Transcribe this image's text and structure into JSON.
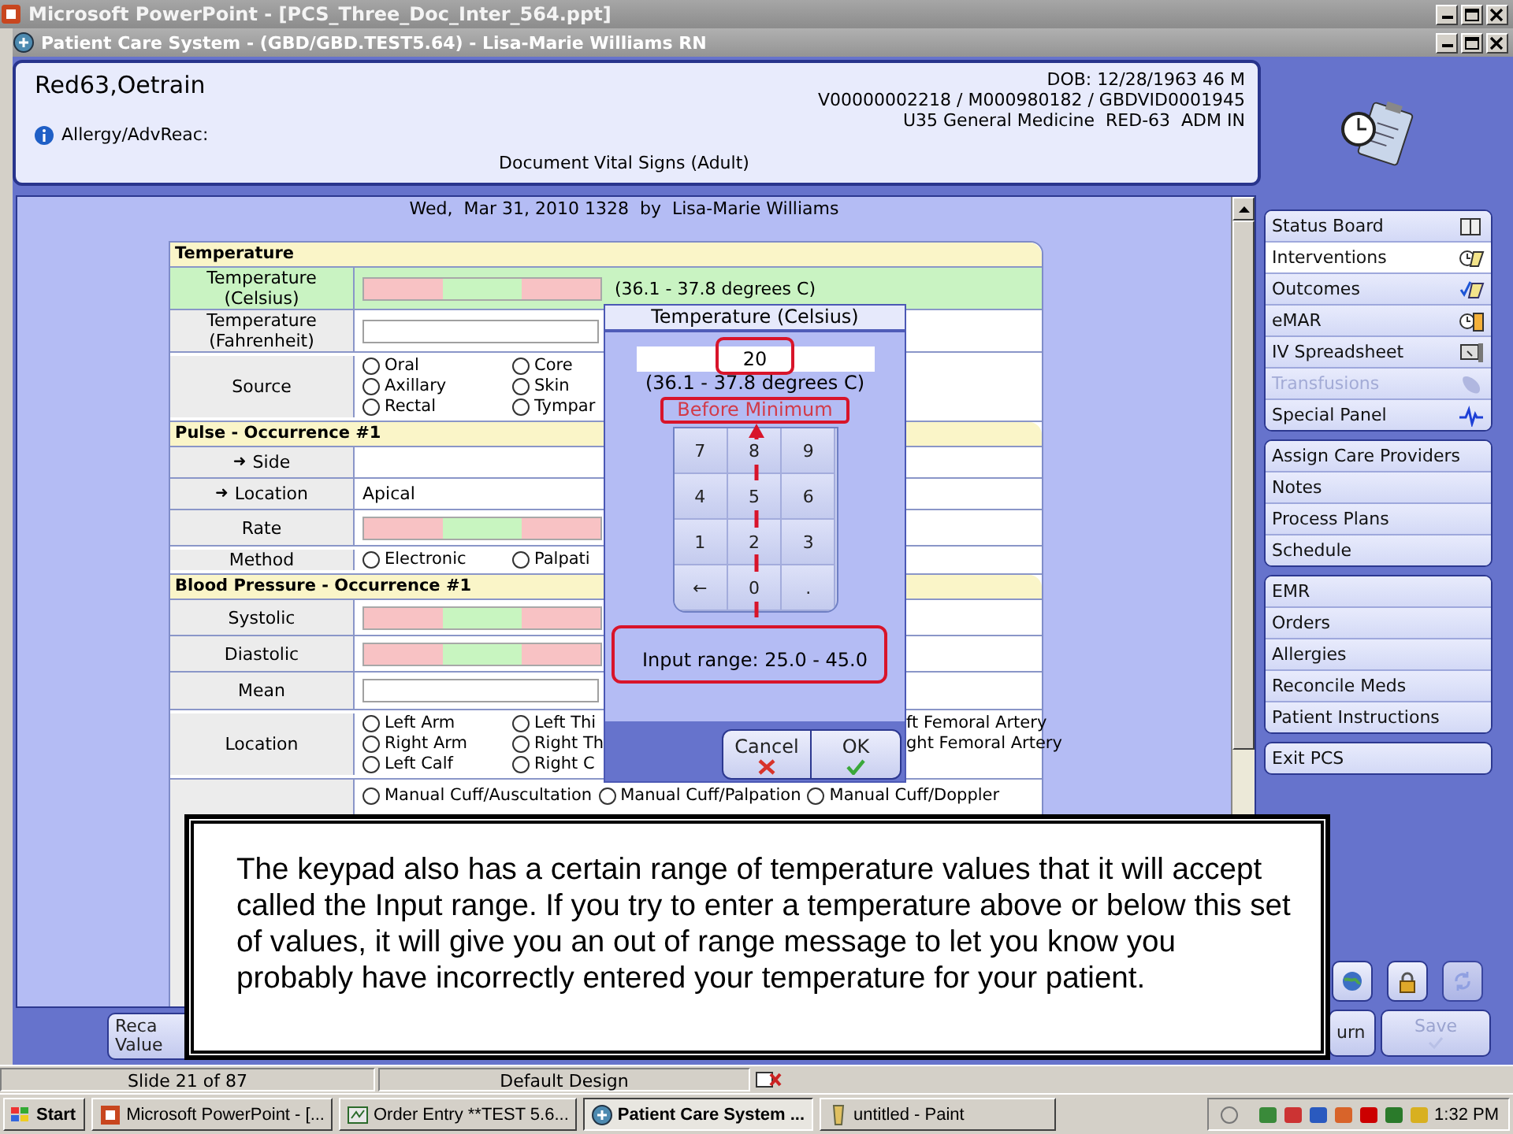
{
  "ppt_window": {
    "title": "Microsoft PowerPoint - [PCS_Three_Doc_Inter_564.ppt]"
  },
  "pcs_window": {
    "title": "Patient Care System - (GBD/GBD.TEST5.64) - Lisa-Marie Williams RN"
  },
  "patient": {
    "name": "Red63,Oetrain",
    "dob": "DOB: 12/28/1963 46 M",
    "ids": "V00000002218 / M000980182 / GBDVID0001945",
    "location": "U35 General Medicine  RED-63  ADM IN",
    "allergy": "Allergy/AdvReac:",
    "document": "Document Vital Signs (Adult)"
  },
  "form": {
    "timestamp": "Wed,  Mar 31, 2010 1328  by  Lisa-Marie Williams",
    "rows": [
      {
        "kind": "section",
        "title": "Temperature"
      },
      {
        "kind": "range",
        "label": "Temperature (Celsius)",
        "active": true,
        "hint": "(36.1 - 37.8 degrees C)"
      },
      {
        "kind": "input",
        "label": "Temperature (Fahrenheit)",
        "active": false
      },
      {
        "kind": "radio",
        "label": "Source",
        "lines": [
          {
            "options": [
              {
                "label": "Oral",
                "selected": false
              },
              {
                "label": "Core",
                "selected": false
              }
            ]
          },
          {
            "options": [
              {
                "label": "Axillary",
                "selected": false
              },
              {
                "label": "Skin",
                "selected": false
              }
            ]
          },
          {
            "options": [
              {
                "label": "Rectal",
                "selected": false
              },
              {
                "label": "Tympar",
                "selected": false
              }
            ]
          }
        ]
      },
      {
        "kind": "section",
        "title": "Pulse - Occurrence #1"
      },
      {
        "kind": "text",
        "pointer": "➜",
        "label": "Side"
      },
      {
        "kind": "text",
        "pointer": "➜",
        "label": "Location",
        "value": "Apical"
      },
      {
        "kind": "range",
        "label": "Rate",
        "active": false
      },
      {
        "kind": "radio",
        "label": "Method",
        "lines": [
          {
            "options": [
              {
                "label": "Electronic",
                "selected": false
              },
              {
                "label": "Palpati",
                "selected": false
              }
            ]
          }
        ]
      },
      {
        "kind": "section",
        "title": "Blood Pressure - Occurrence #1"
      },
      {
        "kind": "range",
        "label": "Systolic",
        "active": false
      },
      {
        "kind": "range",
        "label": "Diastolic",
        "active": false
      },
      {
        "kind": "input",
        "label": "Mean",
        "active": false
      },
      {
        "kind": "radio",
        "label": "Location",
        "lines": [
          {
            "options": [
              {
                "label": "Left Arm",
                "selected": false
              },
              {
                "label": "Left Thi",
                "selected": false
              }
            ],
            "trailing": "ft Femoral Artery"
          },
          {
            "options": [
              {
                "label": "Right Arm",
                "selected": false
              },
              {
                "label": "Right Th",
                "selected": false
              }
            ],
            "trailing": "ght Femoral Artery"
          },
          {
            "options": [
              {
                "label": "Left Calf",
                "selected": false
              },
              {
                "label": "Right C",
                "selected": false
              }
            ]
          }
        ]
      },
      {
        "kind": "choice_line",
        "options": [
          {
            "label": "Manual Cuff/Auscultation",
            "selected": false
          },
          {
            "label": "Manual Cuff/Palpation",
            "selected": false
          },
          {
            "label": "Manual Cuff/Doppler",
            "selected": false
          }
        ]
      }
    ]
  },
  "sidebar": {
    "groups": [
      {
        "items": [
          {
            "label": "Status Board",
            "selected": false,
            "disabled": false
          },
          {
            "label": "Interventions",
            "selected": true,
            "disabled": false
          },
          {
            "label": "Outcomes",
            "selected": false,
            "disabled": false
          },
          {
            "label": "eMAR",
            "selected": false,
            "disabled": false
          },
          {
            "label": "IV Spreadsheet",
            "selected": false,
            "disabled": false
          },
          {
            "label": "Transfusions",
            "selected": false,
            "disabled": true
          },
          {
            "label": "Special Panel",
            "selected": false,
            "disabled": false
          }
        ]
      },
      {
        "items": [
          {
            "label": "Assign Care Providers",
            "selected": false,
            "disabled": false
          },
          {
            "label": "Notes",
            "selected": false,
            "disabled": false
          },
          {
            "label": "Process Plans",
            "selected": false,
            "disabled": false
          },
          {
            "label": "Schedule",
            "selected": false,
            "disabled": false
          }
        ]
      },
      {
        "items": [
          {
            "label": "EMR",
            "selected": false,
            "disabled": false
          },
          {
            "label": "Orders",
            "selected": false,
            "disabled": false
          },
          {
            "label": "Allergies",
            "selected": false,
            "disabled": false
          },
          {
            "label": "Reconcile Meds",
            "selected": false,
            "disabled": false
          },
          {
            "label": "Patient Instructions",
            "selected": false,
            "disabled": false
          }
        ]
      },
      {
        "items": [
          {
            "label": "Exit PCS",
            "selected": false,
            "disabled": false
          }
        ]
      }
    ]
  },
  "tool_buttons": [
    {
      "disabled": false
    },
    {
      "disabled": false
    },
    {
      "disabled": true
    }
  ],
  "bottom_buttons": {
    "left": [
      {
        "lines": [
          "Reca",
          "Value"
        ],
        "disabled": false
      }
    ],
    "right": [
      {
        "lines": [
          "urn"
        ],
        "disabled": false
      },
      {
        "lines": [
          "Save"
        ],
        "disabled": true
      }
    ]
  },
  "keypad": {
    "title": "Temperature (Celsius)",
    "value": "20",
    "hint": "(36.1 - 37.8 degrees C)",
    "message": "Before Minimum",
    "keys": [
      "7",
      "8",
      "9",
      "4",
      "5",
      "6",
      "1",
      "2",
      "3",
      "←",
      "0",
      "."
    ],
    "range": "Input range: 25.0 - 45.0",
    "buttons": [
      {
        "label": "Cancel",
        "kind": "cancel"
      },
      {
        "label": "OK",
        "kind": "ok"
      }
    ]
  },
  "callout": {
    "text": "The keypad also has a certain range of temperature values that it will accept called the Input range. If you try to enter a temperature above or below this set of values, it will give you an out of range message to let you know you probably have incorrectly entered your temperature for your patient."
  },
  "status_bar": {
    "slide": "Slide 21 of 87",
    "design": "Default Design"
  },
  "taskbar": {
    "start": "Start",
    "tasks": [
      {
        "label": "Microsoft PowerPoint - [...",
        "selected": false
      },
      {
        "label": "Order Entry **TEST 5.6...",
        "selected": false
      },
      {
        "label": "Patient Care System ...",
        "selected": true
      },
      {
        "label": "untitled - Paint",
        "selected": false
      }
    ],
    "clock": "1:32 PM"
  }
}
